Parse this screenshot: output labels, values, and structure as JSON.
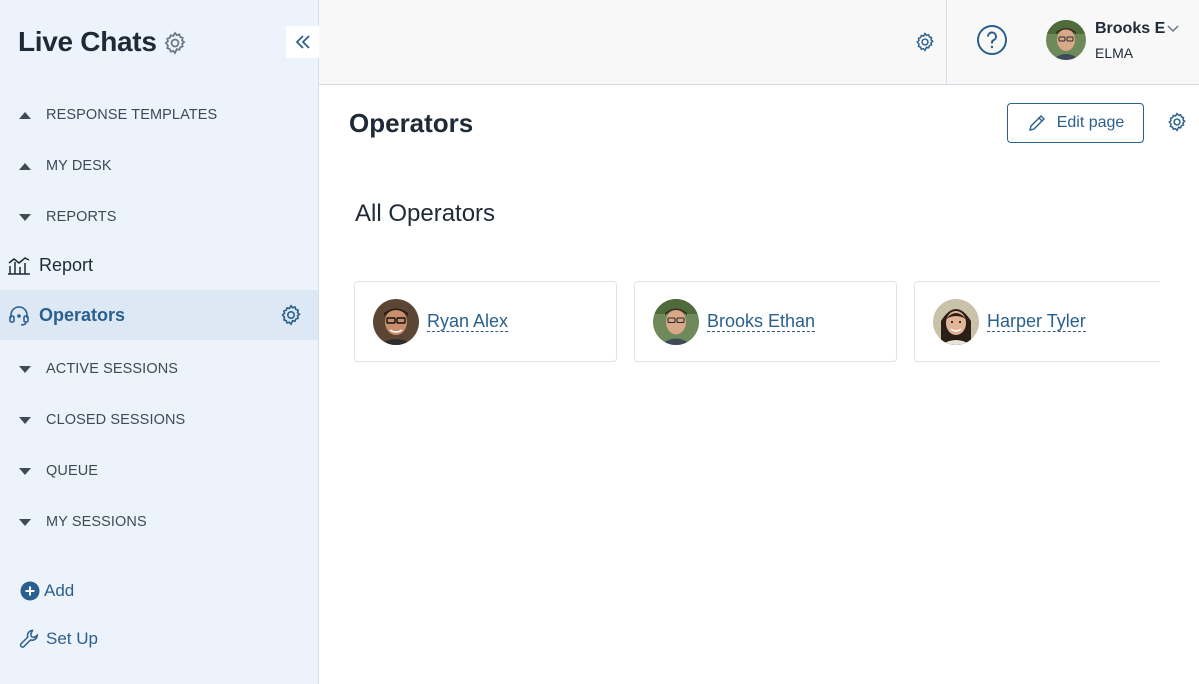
{
  "sidebar": {
    "title": "Live Chats",
    "groups_top": [
      {
        "label": "RESPONSE TEMPLATES",
        "state": "collapsed"
      },
      {
        "label": "MY DESK",
        "state": "collapsed"
      },
      {
        "label": "REPORTS",
        "state": "expanded"
      }
    ],
    "items": [
      {
        "label": "Report",
        "icon": "chart-icon"
      },
      {
        "label": "Operators",
        "icon": "headset-icon",
        "active": true
      }
    ],
    "groups_bottom": [
      {
        "label": "ACTIVE SESSIONS"
      },
      {
        "label": "CLOSED SESSIONS"
      },
      {
        "label": "QUEUE"
      },
      {
        "label": "MY SESSIONS"
      }
    ],
    "actions": {
      "add_label": "Add",
      "setup_label": "Set Up"
    }
  },
  "topbar": {
    "user": {
      "name": "Brooks E",
      "org": "ELMA"
    }
  },
  "main": {
    "title": "Operators",
    "edit_label": "Edit page",
    "section_title": "All Operators",
    "operators": [
      {
        "name": "Ryan Alex"
      },
      {
        "name": "Brooks Ethan"
      },
      {
        "name": "Harper Tyler"
      }
    ]
  },
  "colors": {
    "accent": "#2b5f8e",
    "sidebar_bg": "#ecf3fa",
    "active_bg": "#dce8f3",
    "text": "#1f2a37"
  }
}
